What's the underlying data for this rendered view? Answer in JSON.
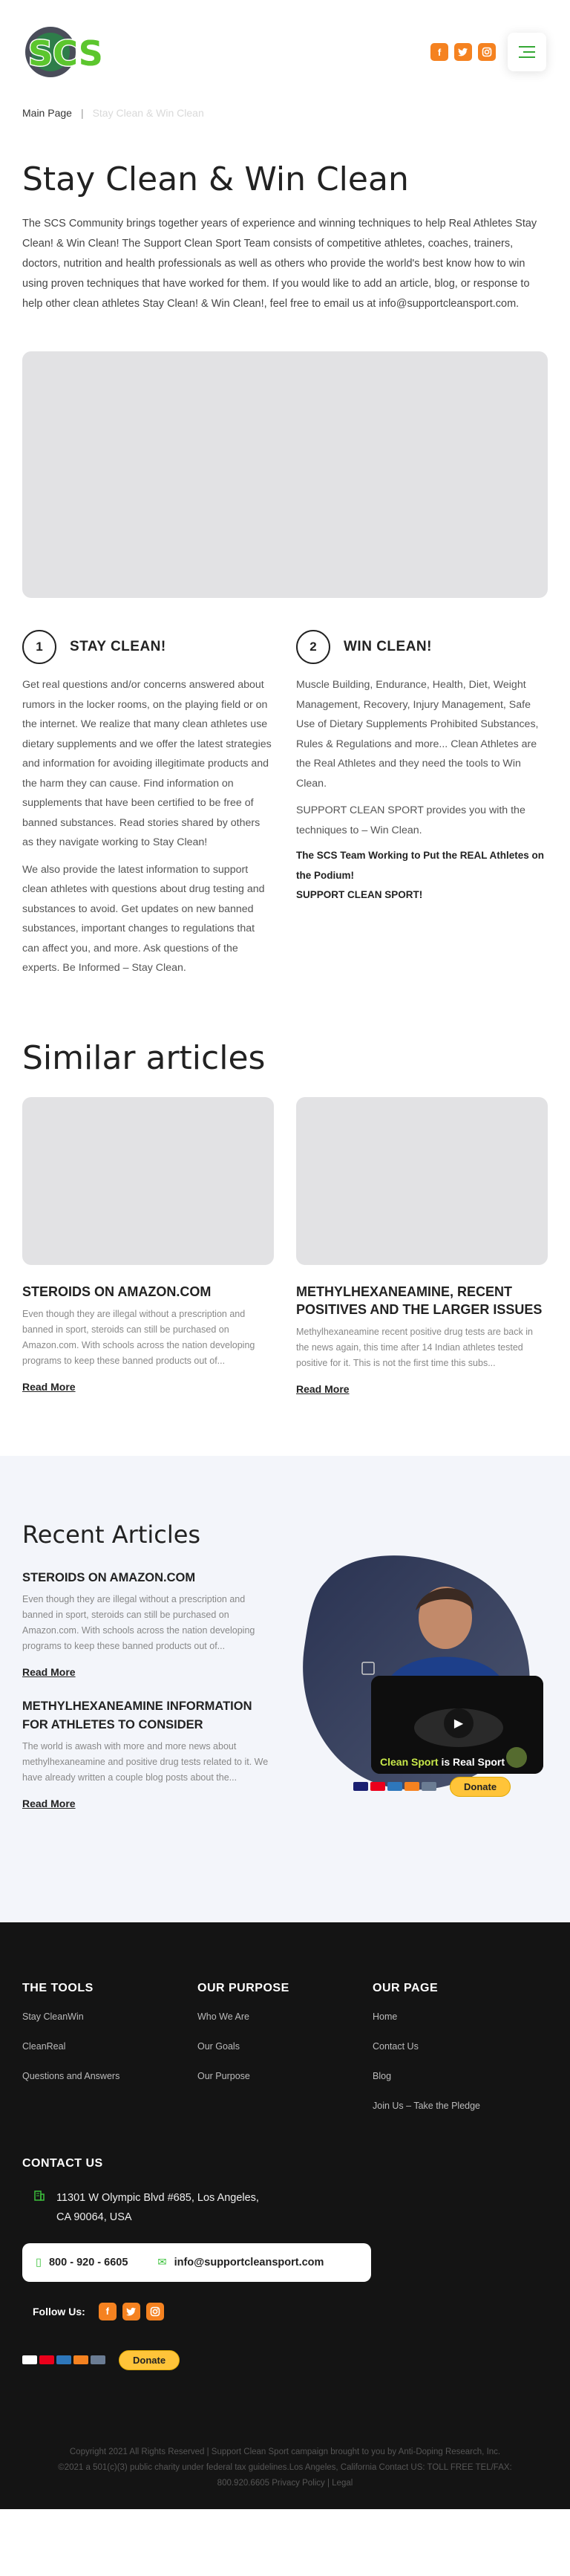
{
  "header": {
    "logo_text": "SCS",
    "social": [
      "f",
      "t",
      "ig"
    ],
    "menu_icon": "hamburger-icon"
  },
  "breadcrumb": {
    "home": "Main Page",
    "separator": "|",
    "current": "Stay Clean & Win Clean"
  },
  "page": {
    "title": "Stay Clean & Win Clean",
    "intro": "The SCS Community brings together years of experience and winning techniques to help Real Athletes Stay Clean! & Win Clean! The Support Clean Sport Team consists of competitive athletes, coaches, trainers, doctors, nutrition and health professionals as well as others who provide the world's best know how to win using proven techniques that have worked for them. If you would like to add an article, blog, or response to help other clean athletes Stay Clean! & Win Clean!, feel free to email us at info@supportcleansport.com."
  },
  "columns": [
    {
      "num": "1",
      "heading": "STAY CLEAN!",
      "p1": "Get real questions and/or concerns answered about rumors in the locker rooms, on the playing field or on the internet. We realize that many clean athletes use dietary supplements and we offer the latest strategies and information for avoiding illegitimate products and the harm they can cause. Find information on supplements that have been certified to be free of banned substances. Read stories shared by others as they navigate working to Stay Clean!",
      "p2": "We also provide the latest information to support clean athletes with questions about drug testing and substances to avoid. Get updates on new banned substances, important changes to regulations that can affect you, and more. Ask questions of the experts. Be Informed – Stay Clean."
    },
    {
      "num": "2",
      "heading": "WIN CLEAN!",
      "p1": "Muscle Building, Endurance, Health, Diet, Weight Management, Recovery, Injury Management, Safe Use of Dietary Supplements Prohibited Substances, Rules & Regulations and more... Clean Athletes are the Real Athletes and they need the tools to Win Clean.",
      "p2": "SUPPORT CLEAN SPORT provides you with the techniques to – Win Clean.",
      "p3": "The SCS Team Working to Put the REAL Athletes on the Podium!",
      "p4": "SUPPORT CLEAN SPORT!"
    }
  ],
  "similar": {
    "heading": "Similar articles",
    "items": [
      {
        "title": "STEROIDS ON AMAZON.COM",
        "excerpt": "Even though they are illegal without a prescription and banned in sport, steroids can still be purchased on Amazon.com. With schools across the nation developing programs to keep these banned products out of...",
        "link": "Read More"
      },
      {
        "title": "METHYLHEXANEAMINE, RECENT POSITIVES AND THE LARGER ISSUES",
        "excerpt": "Methylhexaneamine recent positive drug tests are back in the news again, this time after 14 Indian athletes tested positive for it. This is not the first time this subs...",
        "link": "Read More"
      }
    ]
  },
  "recent": {
    "heading": "Recent Articles",
    "items": [
      {
        "title": "STEROIDS ON AMAZON.COM",
        "excerpt": "Even though they are illegal without a prescription and banned in sport, steroids can still be purchased on Amazon.com. With schools across the nation developing programs to keep these banned products out of...",
        "link": "Read More"
      },
      {
        "title": "METHYLHEXANEAMINE INFORMATION FOR ATHLETES TO CONSIDER",
        "excerpt": "The world is awash with more and more news about methylhexaneamine and positive drug tests related to it. We have already written a couple blog posts about the...",
        "link": "Read More"
      }
    ],
    "video_caption_a": "Clean Sport",
    "video_caption_b": " is Real Sport",
    "donate": "Donate"
  },
  "footer": {
    "tools": {
      "heading": "THE TOOLS",
      "links": [
        "Stay CleanWin",
        "CleanReal",
        "Questions and Answers"
      ]
    },
    "purpose": {
      "heading": "OUR PURPOSE",
      "links": [
        "Who We Are",
        "Our Goals",
        "Our Purpose"
      ]
    },
    "page": {
      "heading": "OUR PAGE",
      "links": [
        "Home",
        "Contact Us",
        "Blog",
        "Join Us – Take the Pledge"
      ]
    },
    "contact": {
      "heading": "CONTACT US",
      "address_1": "11301 W Olympic Blvd #685, Los Angeles,",
      "address_2": "CA 90064, USA",
      "phone": "800 - 920 - 6605",
      "email": "info@supportcleansport.com"
    },
    "follow": "Follow Us:",
    "donate": "Donate",
    "copyright_1": "Copyright 2021 All Rights Reserved | Support Clean Sport campaign brought to you by Anti-Doping Research, Inc.",
    "copyright_2": "©2021 a 501(c)(3) public charity under federal tax guidelines.Los Angeles, California Contact US: TOLL FREE TEL/FAX:",
    "copyright_3": "800.920.6605 Privacy Policy | Legal"
  },
  "colors": {
    "accent_green": "#35a835",
    "social_orange": "#f58220",
    "donate_yellow": "#ffc439",
    "footer_bg": "#141414"
  }
}
